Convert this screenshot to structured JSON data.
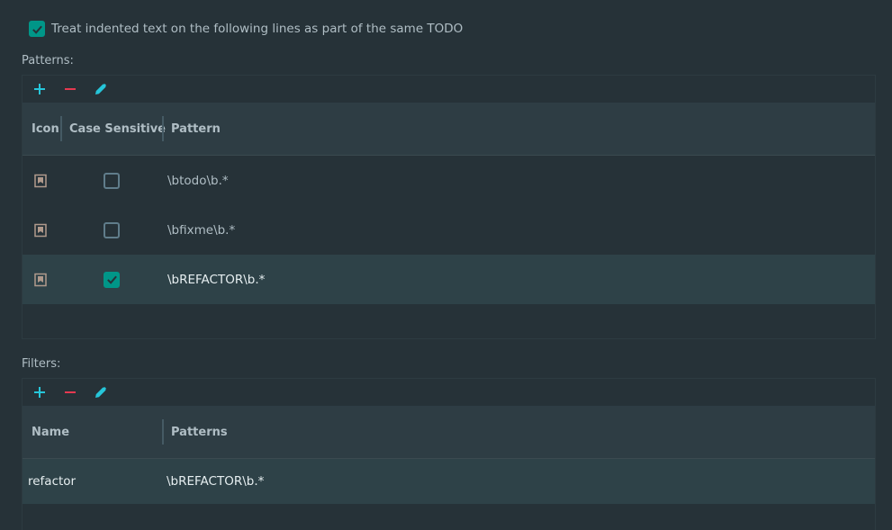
{
  "top_checkbox": {
    "label": "Treat indented text on the following lines as part of the same TODO",
    "checked": true
  },
  "patterns": {
    "section_label": "Patterns:",
    "toolbar": {
      "add_icon": "plus-icon",
      "remove_icon": "minus-icon",
      "edit_icon": "pencil-icon"
    },
    "columns": {
      "icon": "Icon",
      "case_sensitive": "Case Sensitive",
      "pattern": "Pattern"
    },
    "rows": [
      {
        "icon": "todo-bookmark-icon",
        "case_sensitive": false,
        "pattern": "\\btodo\\b.*",
        "selected": false
      },
      {
        "icon": "todo-bookmark-icon",
        "case_sensitive": false,
        "pattern": "\\bfixme\\b.*",
        "selected": false
      },
      {
        "icon": "todo-bookmark-icon",
        "case_sensitive": true,
        "pattern": "\\bREFACTOR\\b.*",
        "selected": true
      }
    ]
  },
  "filters": {
    "section_label": "Filters:",
    "toolbar": {
      "add_icon": "plus-icon",
      "remove_icon": "minus-icon",
      "edit_icon": "pencil-icon"
    },
    "columns": {
      "name": "Name",
      "patterns": "Patterns"
    },
    "rows": [
      {
        "name": "refactor",
        "patterns": "\\bREFACTOR\\b.*",
        "selected": true
      }
    ]
  },
  "colors": {
    "background": "#263238",
    "accent": "#009688",
    "add": "#26c6da",
    "remove": "#e53950",
    "edit": "#26c6da"
  }
}
